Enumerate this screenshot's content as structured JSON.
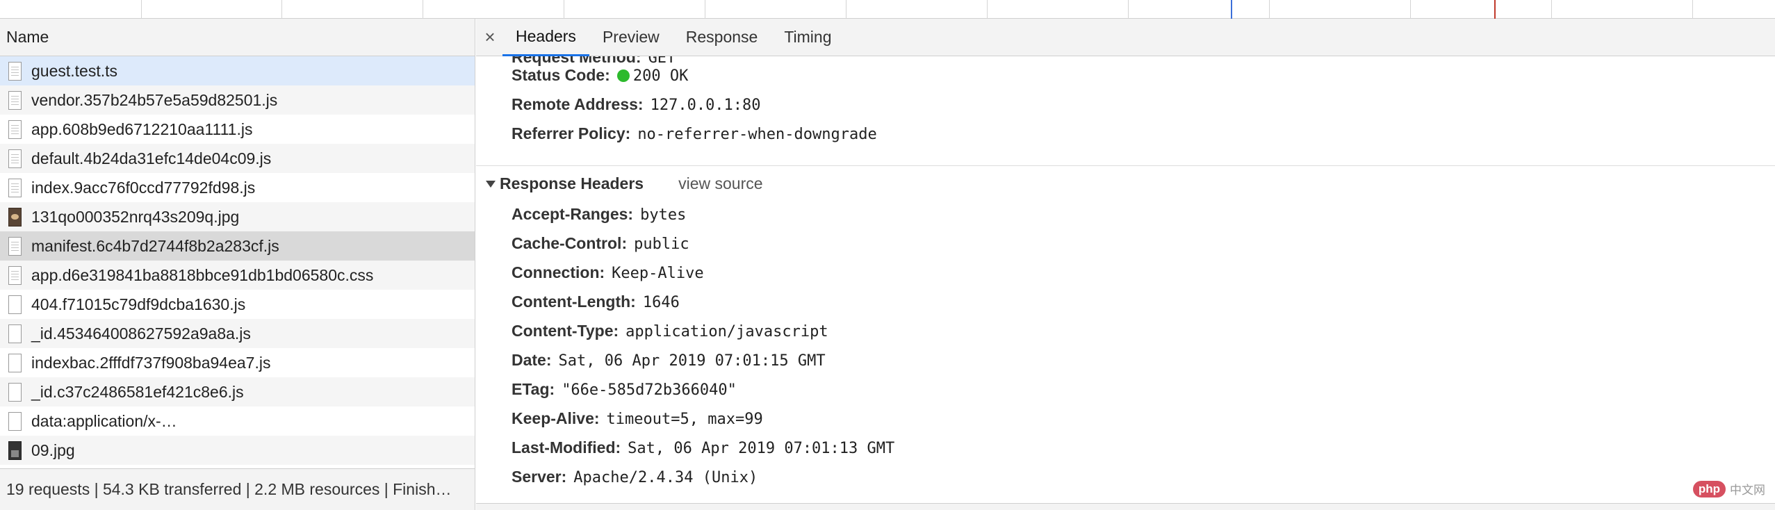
{
  "list": {
    "column_name": "Name",
    "requests": [
      {
        "name": "guest.test.ts",
        "icon": "doc-icon"
      },
      {
        "name": "vendor.357b24b57e5a59d82501.js",
        "icon": "doc-icon"
      },
      {
        "name": "app.608b9ed6712210aa1111.js",
        "icon": "doc-icon"
      },
      {
        "name": "default.4b24da31efc14de04c09.js",
        "icon": "doc-icon"
      },
      {
        "name": "index.9acc76f0ccd77792fd98.js",
        "icon": "doc-icon"
      },
      {
        "name": "131qo000352nrq43s209q.jpg",
        "icon": "image-thumb-icon"
      },
      {
        "name": "manifest.6c4b7d2744f8b2a283cf.js",
        "icon": "doc-icon"
      },
      {
        "name": "app.d6e319841ba8818bbce91db1bd06580c.css",
        "icon": "doc-icon"
      },
      {
        "name": "404.f71015c79df9dcba1630.js",
        "icon": "blank-doc-icon"
      },
      {
        "name": "_id.453464008627592a9a8a.js",
        "icon": "blank-doc-icon"
      },
      {
        "name": "indexbac.2fffdf737f908ba94ea7.js",
        "icon": "blank-doc-icon"
      },
      {
        "name": "_id.c37c2486581ef421c8e6.js",
        "icon": "blank-doc-icon"
      },
      {
        "name": "data:application/x-…",
        "icon": "blank-doc-icon"
      },
      {
        "name": "09.jpg",
        "icon": "image-thumb-icon"
      }
    ],
    "status": "19 requests | 54.3 KB transferred | 2.2 MB resources | Finish…"
  },
  "tabs": {
    "close": "×",
    "headers": "Headers",
    "preview": "Preview",
    "response": "Response",
    "timing": "Timing"
  },
  "general": {
    "request_method_label": "Request Method:",
    "request_method_value": "GET",
    "status_code_label": "Status Code:",
    "status_code_value": "200 OK",
    "remote_address_label": "Remote Address:",
    "remote_address_value": "127.0.0.1:80",
    "referrer_policy_label": "Referrer Policy:",
    "referrer_policy_value": "no-referrer-when-downgrade"
  },
  "response_headers": {
    "title": "Response Headers",
    "view_source": "view source",
    "items": [
      {
        "k": "Accept-Ranges:",
        "v": "bytes"
      },
      {
        "k": "Cache-Control:",
        "v": "public"
      },
      {
        "k": "Connection:",
        "v": "Keep-Alive"
      },
      {
        "k": "Content-Length:",
        "v": "1646"
      },
      {
        "k": "Content-Type:",
        "v": "application/javascript"
      },
      {
        "k": "Date:",
        "v": "Sat, 06 Apr 2019 07:01:15 GMT"
      },
      {
        "k": "ETag:",
        "v": "\"66e-585d72b366040\""
      },
      {
        "k": "Keep-Alive:",
        "v": "timeout=5, max=99"
      },
      {
        "k": "Last-Modified:",
        "v": "Sat, 06 Apr 2019 07:01:13 GMT"
      },
      {
        "k": "Server:",
        "v": "Apache/2.4.34 (Unix)"
      }
    ]
  },
  "watermark": {
    "logo": "php",
    "text": "中文网"
  },
  "colors": {
    "status_ok": "#2dba2d",
    "selected_row": "#ddeafb",
    "active_tab": "#1a73e8"
  }
}
